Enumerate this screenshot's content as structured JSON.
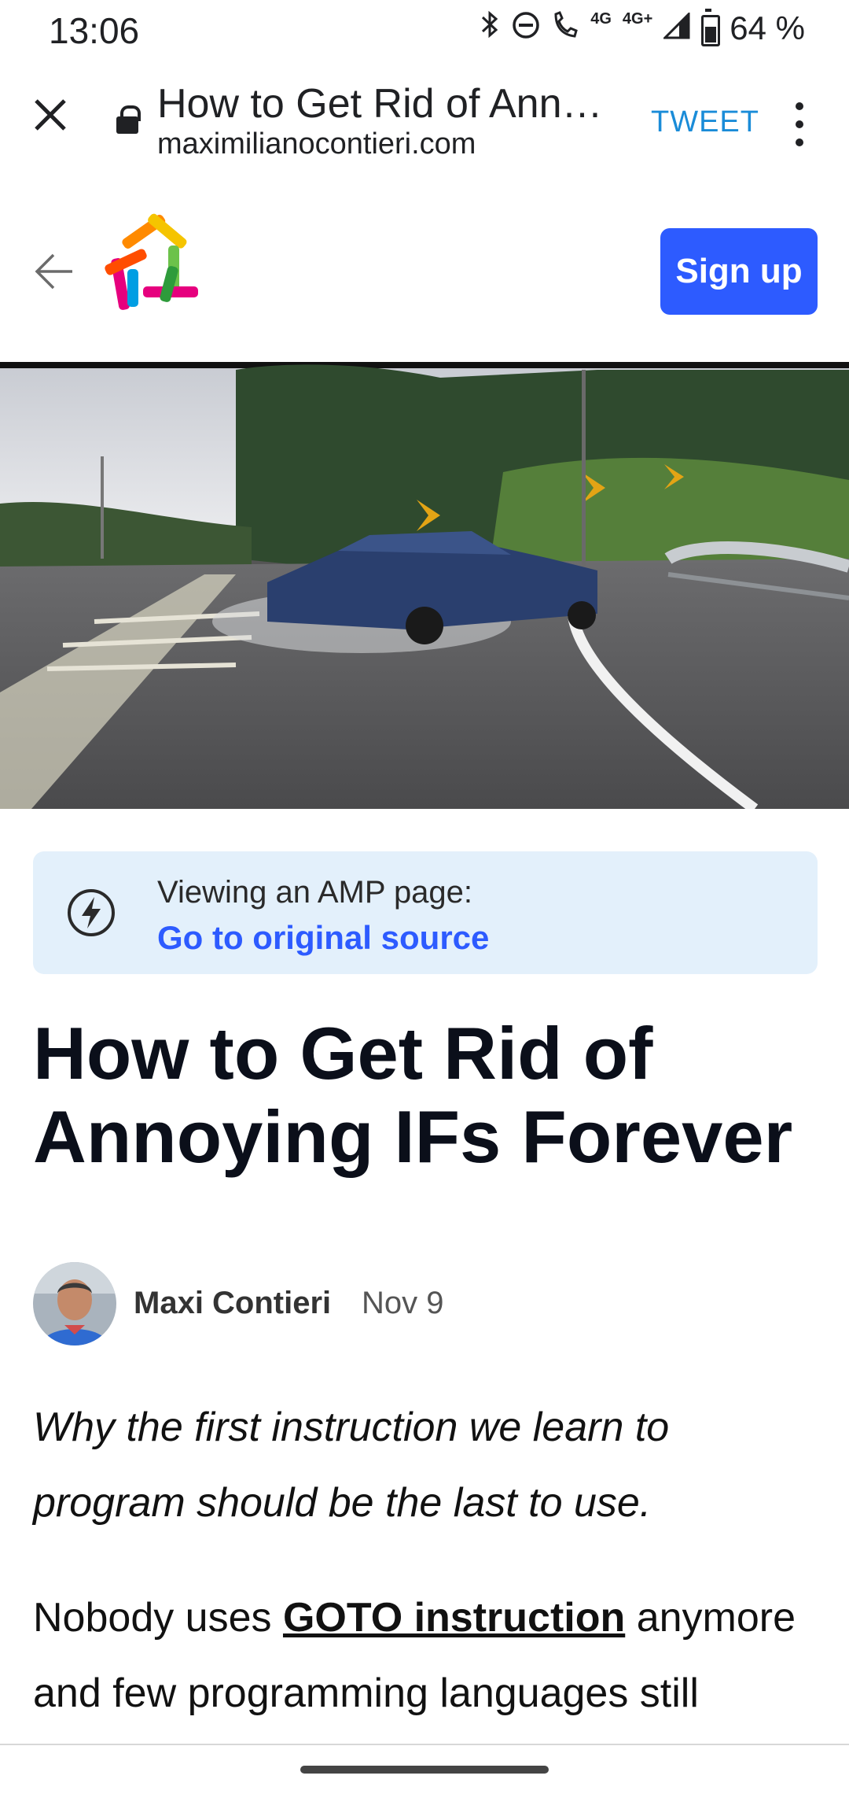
{
  "status_bar": {
    "time": "13:06",
    "battery": "64 %",
    "network_small": "4G",
    "network_label": "4G+",
    "icons": [
      "bluetooth-icon",
      "do-not-disturb-icon",
      "wifi-calling-icon",
      "signal-icon",
      "battery-icon"
    ]
  },
  "toolbar": {
    "title": "How to Get Rid of Ann…",
    "url": "maximilianocontieri.com",
    "tweet_label": "TWEET"
  },
  "site_header": {
    "signup_label": "Sign up"
  },
  "amp_notice": {
    "text": "Viewing an AMP page:",
    "link": "Go to original source"
  },
  "article": {
    "title": "How to Get Rid of Annoying IFs Forever",
    "author": "Maxi Contieri",
    "date": "Nov 9",
    "subtitle": "Why the first instruction we learn to program should be the last to use.",
    "body_prefix": "Nobody uses ",
    "body_link": "GOTO instruction",
    "body_suffix": " anymore and few programming languages still"
  },
  "colors": {
    "accent": "#2d5bff",
    "tweet": "#1a8cd8",
    "amp_bg": "#e3f0fb"
  }
}
